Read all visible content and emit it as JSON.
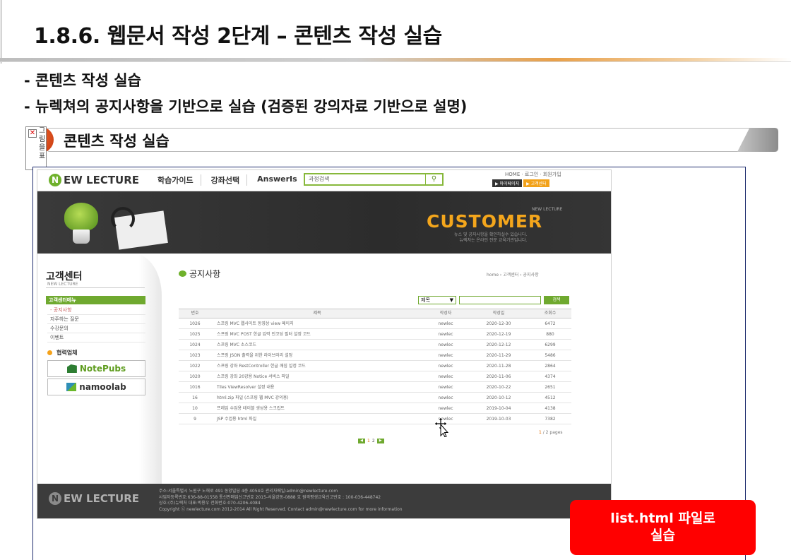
{
  "slide": {
    "title": "1.8.6. 웹문서 작성 2단계 – 콘텐츠 작성 실습",
    "bullets": [
      "- 콘텐츠 작성 실습",
      "- 뉴렉쳐의 공지사항을 기반으로 실습 (검증된 강의자료 기반으로 설명)"
    ],
    "section_label": "콘텐츠 작성 실습",
    "broken_image_text": "그림을 표",
    "callout": "list.html 파일로\n실습"
  },
  "web": {
    "logo": "EW LECTURE",
    "logo_mark": "N",
    "nav": [
      "학습가이드",
      "강좌선택",
      "AnswerIs"
    ],
    "search_placeholder": "과정검색",
    "top_links": "HOME · 로그인 · 회원가입",
    "top_buttons": [
      "▶ 마이페이지",
      "▶ 고객센터"
    ],
    "banner": {
      "tag": "NEW LECTURE",
      "headline": "CUSTOMER",
      "desc_1": "뉴스 및 공지사항을 확인하실수 있습니다.",
      "desc_2": "뉴렉처는 온라인 전문 교육기관입니다."
    },
    "sidebar": {
      "title": "고객센터",
      "subtitle": "NEW LECTURE",
      "menu_header": "고객센터메뉴",
      "items": [
        "- 공지사항",
        "자주하는 질문",
        "수강문의",
        "이벤트"
      ],
      "partner_title": "협력업체",
      "partners": [
        "NotePubs",
        "namoolab"
      ]
    },
    "content": {
      "title": "공지사항",
      "breadcrumb": "home › 고객센터 › 공지사항",
      "search_select": "제목",
      "search_button": "검색",
      "columns": [
        "번호",
        "제목",
        "작성자",
        "작성일",
        "조회수"
      ],
      "rows": [
        {
          "no": "1026",
          "title": "스프링 MVC 웹사이트 동영상 view 페이지",
          "writer": "newlec",
          "date": "2020-12-30",
          "hit": "6472"
        },
        {
          "no": "1025",
          "title": "스프링 MVC POST 한글 입력 인코딩 필터 설정 코드",
          "writer": "newlec",
          "date": "2020-12-19",
          "hit": "880"
        },
        {
          "no": "1024",
          "title": "스프링 MVC 소스코드",
          "writer": "newlec",
          "date": "2020-12-12",
          "hit": "6299"
        },
        {
          "no": "1023",
          "title": "스프링 JSON 출력을 위한 라이브러리 설정",
          "writer": "newlec",
          "date": "2020-11-29",
          "hit": "5486"
        },
        {
          "no": "1022",
          "title": "스프링 강좌 RestController 한글 깨짐 설정 코드",
          "writer": "newlec",
          "date": "2020-11-28",
          "hit": "2864"
        },
        {
          "no": "1020",
          "title": "스프링 강좌 20강용 Notice 서비스 파일",
          "writer": "newlec",
          "date": "2020-11-06",
          "hit": "4374"
        },
        {
          "no": "1016",
          "title": "Tiles ViewResolver 설정 내용",
          "writer": "newlec",
          "date": "2020-10-22",
          "hit": "2651"
        },
        {
          "no": "16",
          "title": "html.zip 파일 (스프링 웹 MVC 강의용)",
          "writer": "newlec",
          "date": "2020-10-12",
          "hit": "4512"
        },
        {
          "no": "10",
          "title": "프레임 수업용 테이블 생성용 스크립트",
          "writer": "newlec",
          "date": "2019-10-04",
          "hit": "4138"
        },
        {
          "no": "9",
          "title": "JSP 수업용 html 파일",
          "writer": "newlec",
          "date": "2019-10-03",
          "hit": "7382"
        }
      ],
      "page_current": "1",
      "page_total": "/ 2 pages",
      "pager_numbers": [
        "1",
        "2"
      ]
    },
    "footer": {
      "logo": "EW LECTURE",
      "lines": [
        "주소:서울특별시 노원구 노해로 491 동양빌딩 4층 4054호          관리자메일:admin@newlecture.com",
        "사업자등록번호:636-88-01558        통신판매업신고번호 2015-서울강동-0888 호        원격평생교육신고번호 : 100-036-448742",
        "상호:(주)뉴렉처          대표:박용우          전화번호:070-4206-4084",
        "Copyright ⓒ newlecture.com 2012-2014 All Right Reserved. Contact admin@newlecture.com for more information"
      ]
    }
  },
  "colors": {
    "brand_green": "#6fa92f",
    "banner_orange": "#f4a61c",
    "callout_red": "#ff0000",
    "section_circle": "#e0501d"
  }
}
